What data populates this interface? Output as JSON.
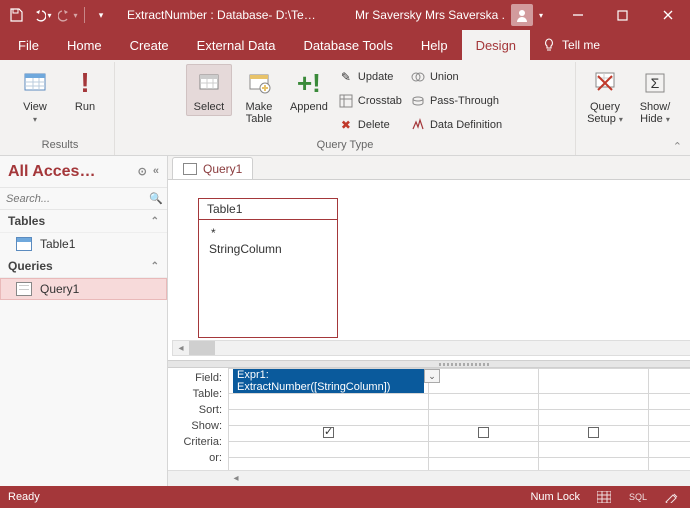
{
  "titlebar": {
    "title": "ExtractNumber : Database- D:\\Te…",
    "user": "Mr Saversky Mrs Saverska ."
  },
  "menu": {
    "file": "File",
    "home": "Home",
    "create": "Create",
    "external": "External Data",
    "tools": "Database Tools",
    "help": "Help",
    "design": "Design",
    "tellme": "Tell me"
  },
  "ribbon": {
    "results": {
      "label": "Results",
      "view": "View",
      "run": "Run"
    },
    "qtype": {
      "label": "Query Type",
      "select": "Select",
      "maketable": "Make\nTable",
      "append": "Append",
      "update": "Update",
      "crosstab": "Crosstab",
      "delete": "Delete",
      "union": "Union",
      "passthrough": "Pass-Through",
      "datadef": "Data Definition"
    },
    "setup": {
      "query": "Query\nSetup",
      "showhide": "Show/\nHide"
    }
  },
  "nav": {
    "header": "All Acces…",
    "search_ph": "Search...",
    "sections": {
      "tables": "Tables",
      "queries": "Queries"
    },
    "items": {
      "table1": "Table1",
      "query1": "Query1"
    }
  },
  "doc": {
    "tab": "Query1",
    "tablebox": {
      "title": "Table1",
      "star": "*",
      "col": "StringColumn"
    }
  },
  "grid": {
    "labels": {
      "field": "Field:",
      "table": "Table:",
      "sort": "Sort:",
      "show": "Show:",
      "criteria": "Criteria:",
      "or": "or:"
    },
    "field_value": "Expr1: ExtractNumber([StringColumn])"
  },
  "status": {
    "ready": "Ready",
    "numlock": "Num Lock",
    "sql": "SQL"
  }
}
